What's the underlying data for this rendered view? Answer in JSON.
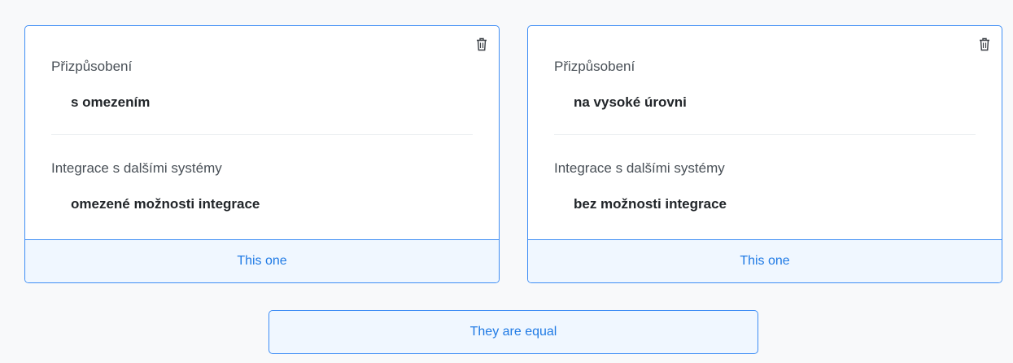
{
  "options": [
    {
      "attributes": [
        {
          "name": "Přizpůsobení",
          "value": "s omezením"
        },
        {
          "name": "Integrace s dalšími systémy",
          "value": "omezené možnosti integrace"
        }
      ],
      "button_label": "This one",
      "delete_icon": "trash-icon"
    },
    {
      "attributes": [
        {
          "name": "Přizpůsobení",
          "value": "na vysoké úrovni"
        },
        {
          "name": "Integrace s dalšími systémy",
          "value": "bez možnosti integrace"
        }
      ],
      "button_label": "This one",
      "delete_icon": "trash-icon"
    }
  ],
  "equal_button_label": "They are equal",
  "colors": {
    "accent": "#1f7ae5",
    "border": "#3f8ef5",
    "button_bg": "#f0f7ff",
    "page_bg": "#f8f9fa"
  }
}
